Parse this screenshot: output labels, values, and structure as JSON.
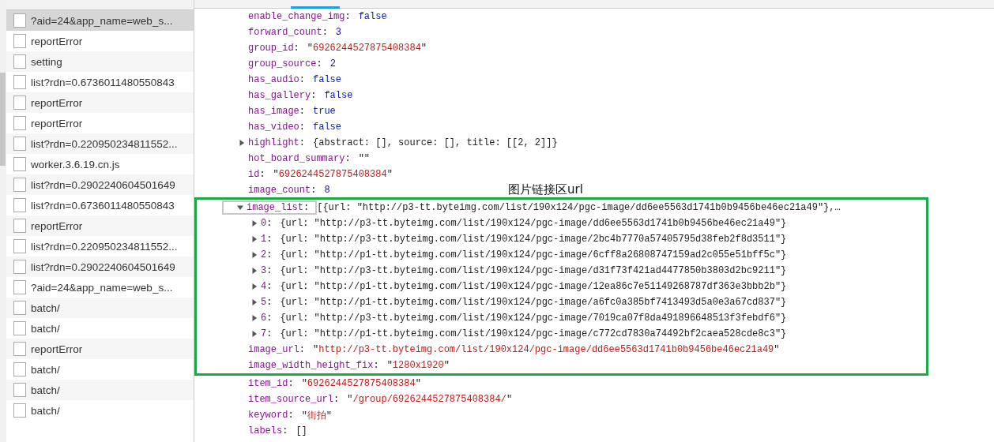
{
  "requests": [
    {
      "name": "?aid=24&app_name=web_s...",
      "selected": true
    },
    {
      "name": "reportError",
      "selected": false
    },
    {
      "name": "setting",
      "selected": false
    },
    {
      "name": "list?rdn=0.6736011480550843",
      "selected": false
    },
    {
      "name": "reportError",
      "selected": false
    },
    {
      "name": "reportError",
      "selected": false
    },
    {
      "name": "list?rdn=0.220950234811552...",
      "selected": false
    },
    {
      "name": "worker.3.6.19.cn.js",
      "selected": false
    },
    {
      "name": "list?rdn=0.2902240604501649",
      "selected": false
    },
    {
      "name": "list?rdn=0.6736011480550843",
      "selected": false
    },
    {
      "name": "reportError",
      "selected": false
    },
    {
      "name": "list?rdn=0.220950234811552...",
      "selected": false
    },
    {
      "name": "list?rdn=0.2902240604501649",
      "selected": false
    },
    {
      "name": "?aid=24&app_name=web_s...",
      "selected": false
    },
    {
      "name": "batch/",
      "selected": false
    },
    {
      "name": "batch/",
      "selected": false
    },
    {
      "name": "reportError",
      "selected": false
    },
    {
      "name": "batch/",
      "selected": false
    },
    {
      "name": "batch/",
      "selected": false
    },
    {
      "name": "batch/",
      "selected": false
    }
  ],
  "preview": {
    "properties_before": [
      {
        "key": "enable_change_img:",
        "value": "false",
        "kind": "boolean"
      },
      {
        "key": "forward_count:",
        "value": "3",
        "kind": "number"
      },
      {
        "key": "group_id:",
        "value": "\"6926244527875408384\"",
        "kind": "string"
      },
      {
        "key": "group_source:",
        "value": "2",
        "kind": "number"
      },
      {
        "key": "has_audio:",
        "value": "false",
        "kind": "boolean"
      },
      {
        "key": "has_gallery:",
        "value": "false",
        "kind": "boolean"
      },
      {
        "key": "has_image:",
        "value": "true",
        "kind": "boolean"
      },
      {
        "key": "has_video:",
        "value": "false",
        "kind": "boolean"
      },
      {
        "key": "highlight:",
        "value": "{abstract: [], source: [], title: [[2, 2]]}",
        "kind": "preview",
        "expanded": false
      },
      {
        "key": "hot_board_summary:",
        "value": "\"\"",
        "kind": "preview"
      },
      {
        "key": "id:",
        "value": "\"6926244527875408384\"",
        "kind": "string"
      },
      {
        "key": "image_count:",
        "value": "8",
        "kind": "number"
      }
    ],
    "annotation": {
      "label": "图片链接区url",
      "properties": [
        {
          "key": "image_list:",
          "value": "[{url: \"http://p3-tt.byteimg.com/list/190x124/pgc-image/dd6ee5563d1741b0b9456be46ec21a49\"},…",
          "kind": "preview",
          "expanded": true,
          "focused": true,
          "children": [
            {
              "key": "0:",
              "value": "{url: \"http://p3-tt.byteimg.com/list/190x124/pgc-image/dd6ee5563d1741b0b9456be46ec21a49\"}",
              "kind": "preview",
              "expanded": false
            },
            {
              "key": "1:",
              "value": "{url: \"http://p3-tt.byteimg.com/list/190x124/pgc-image/2bc4b7770a57405795d38feb2f8d3511\"}",
              "kind": "preview",
              "expanded": false
            },
            {
              "key": "2:",
              "value": "{url: \"http://p1-tt.byteimg.com/list/190x124/pgc-image/6cff8a26808747159ad2c055e51bff5c\"}",
              "kind": "preview",
              "expanded": false
            },
            {
              "key": "3:",
              "value": "{url: \"http://p3-tt.byteimg.com/list/190x124/pgc-image/d31f73f421ad4477850b3803d2bc9211\"}",
              "kind": "preview",
              "expanded": false
            },
            {
              "key": "4:",
              "value": "{url: \"http://p1-tt.byteimg.com/list/190x124/pgc-image/12ea86c7e51149268787df363e3bbb2b\"}",
              "kind": "preview",
              "expanded": false
            },
            {
              "key": "5:",
              "value": "{url: \"http://p1-tt.byteimg.com/list/190x124/pgc-image/a6fc0a385bf7413493d5a0e3a67cd837\"}",
              "kind": "preview",
              "expanded": false
            },
            {
              "key": "6:",
              "value": "{url: \"http://p3-tt.byteimg.com/list/190x124/pgc-image/7019ca07f8da491896648513f3febdf6\"}",
              "kind": "preview",
              "expanded": false
            },
            {
              "key": "7:",
              "value": "{url: \"http://p1-tt.byteimg.com/list/190x124/pgc-image/c772cd7830a74492bf2caea528cde8c3\"}",
              "kind": "preview",
              "expanded": false
            }
          ]
        },
        {
          "key": "image_url:",
          "value": "\"http://p3-tt.byteimg.com/list/190x124/pgc-image/dd6ee5563d1741b0b9456be46ec21a49\"",
          "kind": "string"
        },
        {
          "key": "image_width_height_fix:",
          "value": "\"1280x1920\"",
          "kind": "string"
        }
      ]
    },
    "properties_after": [
      {
        "key": "item_id:",
        "value": "\"6926244527875408384\"",
        "kind": "string"
      },
      {
        "key": "item_source_url:",
        "value": "\"/group/6926244527875408384/\"",
        "kind": "string"
      },
      {
        "key": "keyword:",
        "value": "\"街拍\"",
        "kind": "string"
      },
      {
        "key": "labels:",
        "value": "[]",
        "kind": "preview"
      }
    ]
  }
}
